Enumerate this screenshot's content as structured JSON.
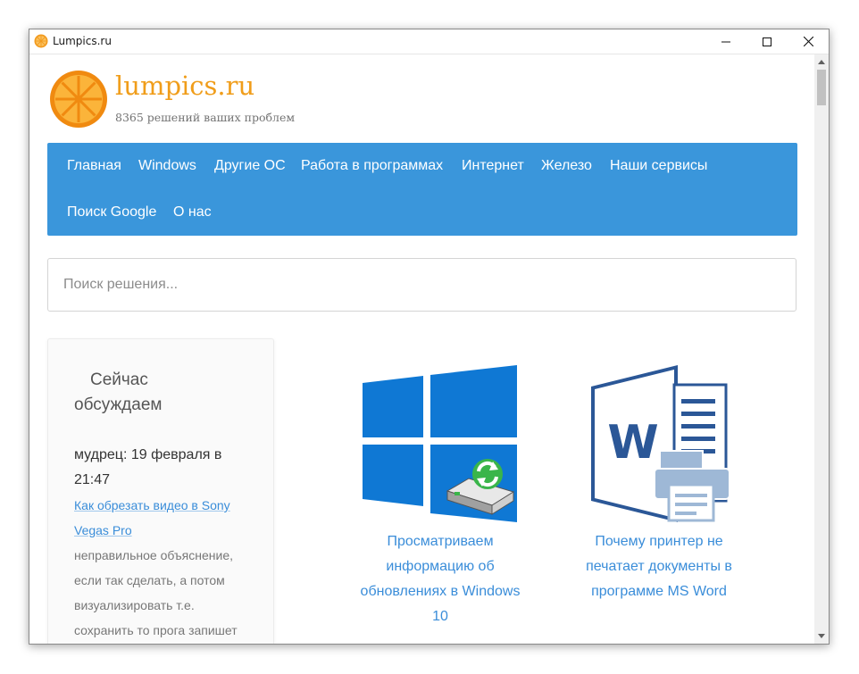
{
  "window": {
    "title": "Lumpics.ru"
  },
  "site": {
    "name": "lumpics.ru",
    "tagline": "8365 решений ваших проблем"
  },
  "nav": {
    "items": [
      {
        "label": "Главная"
      },
      {
        "label": "Windows"
      },
      {
        "label": "Другие ОС"
      },
      {
        "label": "Работа в программах"
      },
      {
        "label": "Интернет"
      },
      {
        "label": "Железо"
      },
      {
        "label": "Наши сервисы"
      },
      {
        "label": "Поиск Google"
      },
      {
        "label": "О нас"
      }
    ]
  },
  "search": {
    "placeholder": "Поиск решения..."
  },
  "sidebar": {
    "title_line1": "Сейчас",
    "title_line2": "обсуждаем",
    "comment": {
      "author_date": "мудрец: 19 февраля в 21:47",
      "article_link": "Как обрезать видео в Sony Vegas Pro",
      "text": "неправильное объяснение, если так сделать, а потом визуализировать т.е. сохранить то прога запишет"
    }
  },
  "articles": [
    {
      "title": "Просматриваем информацию об обновлениях в Windows 10",
      "icon": "windows-update-icon"
    },
    {
      "title": "Почему принтер не печатает документы в программе MS Word",
      "icon": "word-printer-icon"
    }
  ],
  "colors": {
    "accent": "#3a96db",
    "brand_orange": "#f09d1a",
    "link": "#3a8dd9"
  }
}
